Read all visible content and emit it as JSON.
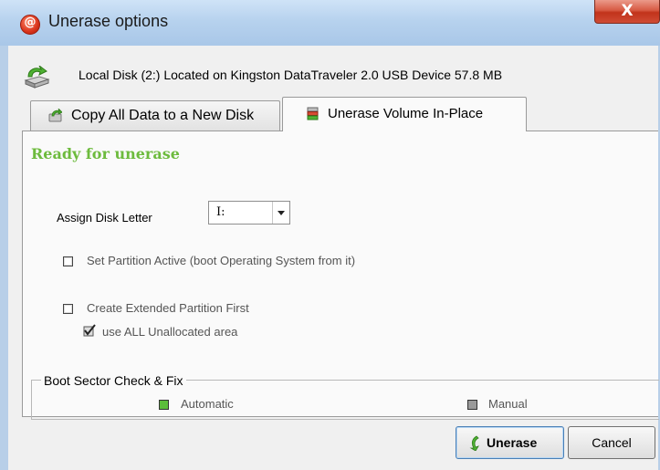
{
  "window": {
    "title": "Unerase options",
    "close_symbol": "X"
  },
  "disk": {
    "info": "Local Disk (2:) Located on Kingston DataTraveler 2.0 USB Device 57.8 MB"
  },
  "tabs": [
    {
      "label": "Copy All Data to a New Disk",
      "active": false
    },
    {
      "label": "Unerase Volume In-Place",
      "active": true
    }
  ],
  "panel": {
    "status": "Ready for unerase",
    "assign_letter_label": "Assign Disk Letter",
    "assign_letter_value": "I:",
    "set_active_label": "Set Partition Active (boot Operating System from it)",
    "set_active_checked": false,
    "extended_label": "Create Extended Partition First",
    "extended_checked": false,
    "use_all_label": "use ALL Unallocated area",
    "use_all_checked": true,
    "boot_group_title": "Boot Sector Check & Fix",
    "boot_options": [
      {
        "label": "Automatic",
        "selected": true
      },
      {
        "label": "Manual",
        "selected": false
      }
    ]
  },
  "buttons": {
    "unerase": "Unerase",
    "cancel": "Cancel"
  },
  "colors": {
    "status_green": "#6dbb3d",
    "title_bar": "#b7d2ee",
    "close_red": "#c2331b"
  }
}
